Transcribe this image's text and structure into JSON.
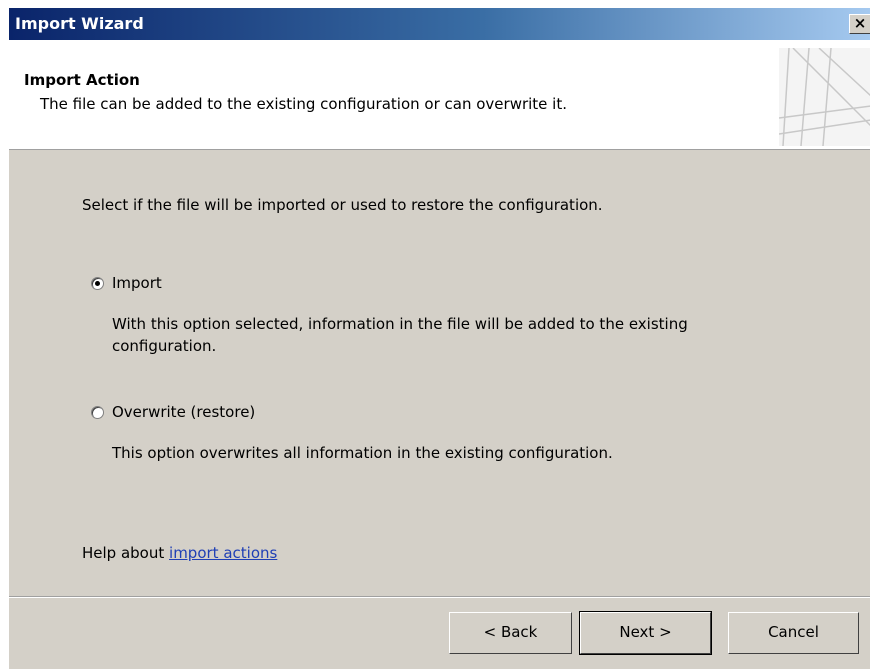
{
  "window": {
    "title": "Import Wizard",
    "close_glyph": "×"
  },
  "header": {
    "title": "Import Action",
    "subtitle": "The file can be added to the existing configuration or can overwrite it."
  },
  "content": {
    "instruction": "Select if the file will be imported or used to restore the configuration.",
    "options": [
      {
        "label": "Import",
        "description_line1": "With this option selected, information in the file will be added to the existing",
        "description_line2": "configuration.",
        "selected": true
      },
      {
        "label": "Overwrite (restore)",
        "description_line1": "This option overwrites all information in the existing configuration.",
        "selected": false
      }
    ],
    "help_prefix": "Help about",
    "help_link": "import actions"
  },
  "buttons": {
    "back": "< Back",
    "next": "Next >",
    "cancel": "Cancel"
  },
  "colors": {
    "titlebar_start": "#0a246a",
    "titlebar_end": "#a6caf0",
    "dialog_background": "#d4d0c8",
    "link": "#1f3fb5"
  },
  "icons": {
    "close": "close-icon",
    "header_graphic": "wizard-banner-graphic"
  }
}
